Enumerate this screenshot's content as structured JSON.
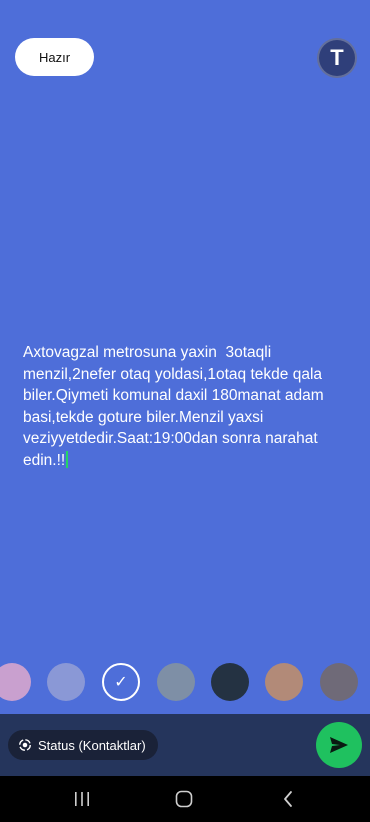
{
  "header": {
    "done_label": "Hazır",
    "avatar_letter": "T"
  },
  "editor": {
    "text": "Axtovagzal metrosuna yaxin  3otaqli menzil,2nefer otaq yoldasi,1otaq tekde qala biler.Qiymeti komunal daxil 180manat adam basi,tekde goture biler.Menzil yaxsi veziyyetdedir.Saat:19:00dan sonra narahat edin.!!",
    "background_color": "#4e6ed9",
    "caret_color": "#25d366"
  },
  "color_palette": {
    "swatches": [
      {
        "color": "#c9a0cf",
        "selected": false
      },
      {
        "color": "#8a98d6",
        "selected": false
      },
      {
        "color": "#4e6ed9",
        "selected": true
      },
      {
        "color": "#7e8fa6",
        "selected": false
      },
      {
        "color": "#243242",
        "selected": false
      },
      {
        "color": "#b28a78",
        "selected": false
      },
      {
        "color": "#6f6a78",
        "selected": false
      }
    ],
    "check_glyph": "✓"
  },
  "bottom_bar": {
    "audience_label": "Status (Kontaktlar)",
    "audience_icon": "status-ring-icon",
    "send_icon": "send-icon",
    "send_color": "#1fc15f"
  },
  "nav": {
    "recents_icon": "recent-apps-icon",
    "home_icon": "home-icon",
    "back_icon": "back-icon"
  }
}
